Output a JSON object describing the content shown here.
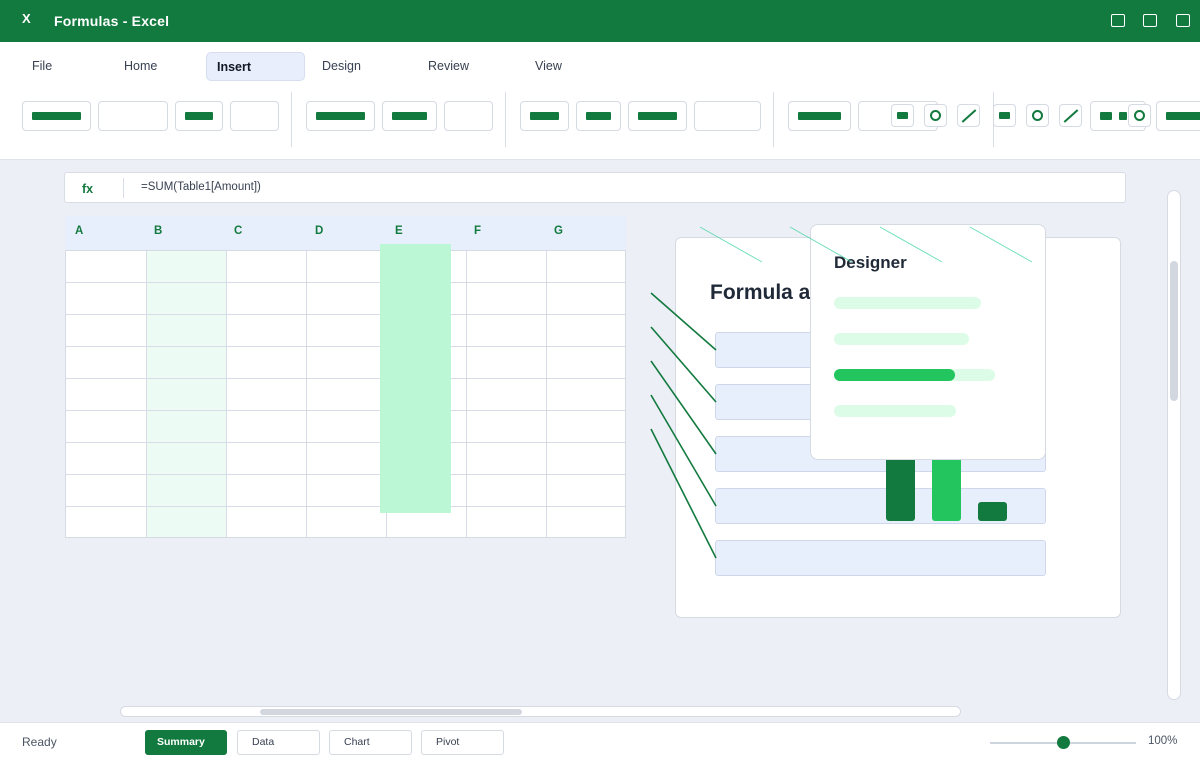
{
  "window": {
    "app_glyph": "X",
    "title": "Formulas - Excel",
    "controls": [
      "minimize-icon",
      "maximize-icon",
      "close-icon"
    ]
  },
  "ribbon": {
    "tabs": [
      {
        "label": "File",
        "active": false
      },
      {
        "label": "Home",
        "active": false
      },
      {
        "label": "Insert",
        "active": true
      },
      {
        "label": "Design",
        "active": false
      },
      {
        "label": "Review",
        "active": false
      },
      {
        "label": "View",
        "active": false
      }
    ],
    "icons": [
      "shape-rectangle-icon",
      "shape-circle-icon",
      "shape-line-icon"
    ]
  },
  "formula_bar": {
    "label": "fx",
    "value": "=SUM(Table1[Amount])"
  },
  "grid": {
    "columns": [
      "A",
      "B",
      "C",
      "D",
      "E",
      "F",
      "G"
    ],
    "highlighted_column": "E"
  },
  "card": {
    "title": "Formula a"
  },
  "chart": {
    "bar_levels": [
      0.58,
      0.67,
      0.12
    ],
    "colors": [
      "#137a3f",
      "#22c55e",
      "#137a3f"
    ]
  },
  "designer": {
    "title": "Designer",
    "progress_level": 0.75
  },
  "status": {
    "text": "Ready",
    "sheet_tabs": [
      {
        "label": "Summary",
        "active": true
      },
      {
        "label": "Data",
        "active": false
      },
      {
        "label": "Chart",
        "active": false
      },
      {
        "label": "Pivot",
        "active": false
      }
    ],
    "zoom": "100%",
    "zoom_level": 0.5
  },
  "colors": {
    "brand": "#137a3f",
    "accent": "#22c55e",
    "highlight": "#bbf7d4",
    "header_fill": "#e8effc"
  }
}
